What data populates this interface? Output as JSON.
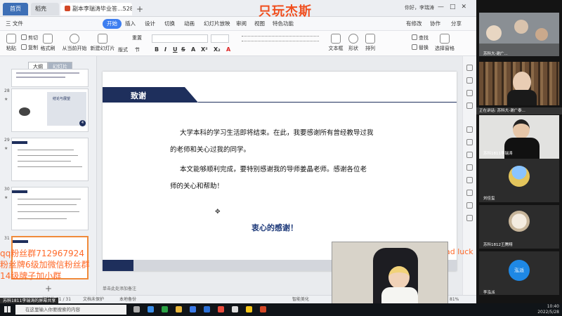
{
  "window": {
    "tabs": [
      "首页",
      "稻壳",
      "副本李瑞涛毕业答...528.pptx"
    ],
    "user": "你好，李瑞涛"
  },
  "brand_overlay": "只玩杰斯",
  "menu": {
    "items": [
      "三 文件",
      "开始",
      "插入",
      "设计",
      "切换",
      "动画",
      "幻灯片放映",
      "审阅",
      "视图",
      "特色功能"
    ],
    "right": [
      "有修改",
      "协作",
      "分享"
    ]
  },
  "ribbon": {
    "paste": "粘贴",
    "cut": "剪切",
    "copy": "复制",
    "format_painter": "格式刷",
    "play_from_current": "从当前开始",
    "new_slide": "新建幻灯片",
    "layout": "版式",
    "section": "节",
    "reset": "重置",
    "text_box": "文本框",
    "shape": "形状",
    "arrange": "排列",
    "find": "查找",
    "replace": "替换",
    "select_pane": "选择窗格",
    "fmt_buttons": [
      "B",
      "I",
      "U",
      "S",
      "A",
      "X²",
      "X₂",
      "A"
    ]
  },
  "left_panel": {
    "tabs": [
      "大纲",
      "幻灯片"
    ],
    "slide_numbers": [
      "28",
      "29",
      "30",
      "31"
    ],
    "thumb_28_text": "结论与展望",
    "thumb_28_badge": "4",
    "add": "+"
  },
  "slide": {
    "header_title": "致谢",
    "paragraph1_line1": "大学本科的学习生活即将结束。在此，我要感谢所有曾经教导过我",
    "paragraph1_line2": "的老师和关心过我的同学。",
    "paragraph2_line1": "本文能够顺利完成，要特别感谢我的导师姜晶老师。感谢各位老",
    "paragraph2_line2": "师的关心和帮助！",
    "closing": "衷心的感谢！"
  },
  "notes_placeholder": "单击此处添加备注",
  "status": {
    "left": "幻灯片 31 / 31",
    "protect": "文档未保护",
    "backup": "本地备份",
    "beautify": "智能美化",
    "zoom": "81%"
  },
  "watermark": {
    "lines": [
      "qq粉丝群712967924",
      "粉丝牌6级加微信粉丝群",
      "14级牌子加小群"
    ],
    "right_text": "ad luck"
  },
  "sharing_pill": "苏科1811李瑞涛的屏幕共享",
  "video_panel": {
    "speaking": "正在讲话: 苏科大-谢广泰...",
    "participants": [
      {
        "label": "苏科大-谢广..."
      },
      {
        "label": "苏科大-谢广泰..."
      },
      {
        "label": "苏科1811李瑞涛"
      },
      {
        "label": "刘佳玺"
      },
      {
        "label": "苏科1812王腾翔"
      },
      {
        "label": "李泓派",
        "avatar_text": "泓派"
      }
    ]
  },
  "taskbar": {
    "search_placeholder": "在这里输入你要搜索的内容",
    "time": "10:40",
    "date": "2022/5/28"
  }
}
